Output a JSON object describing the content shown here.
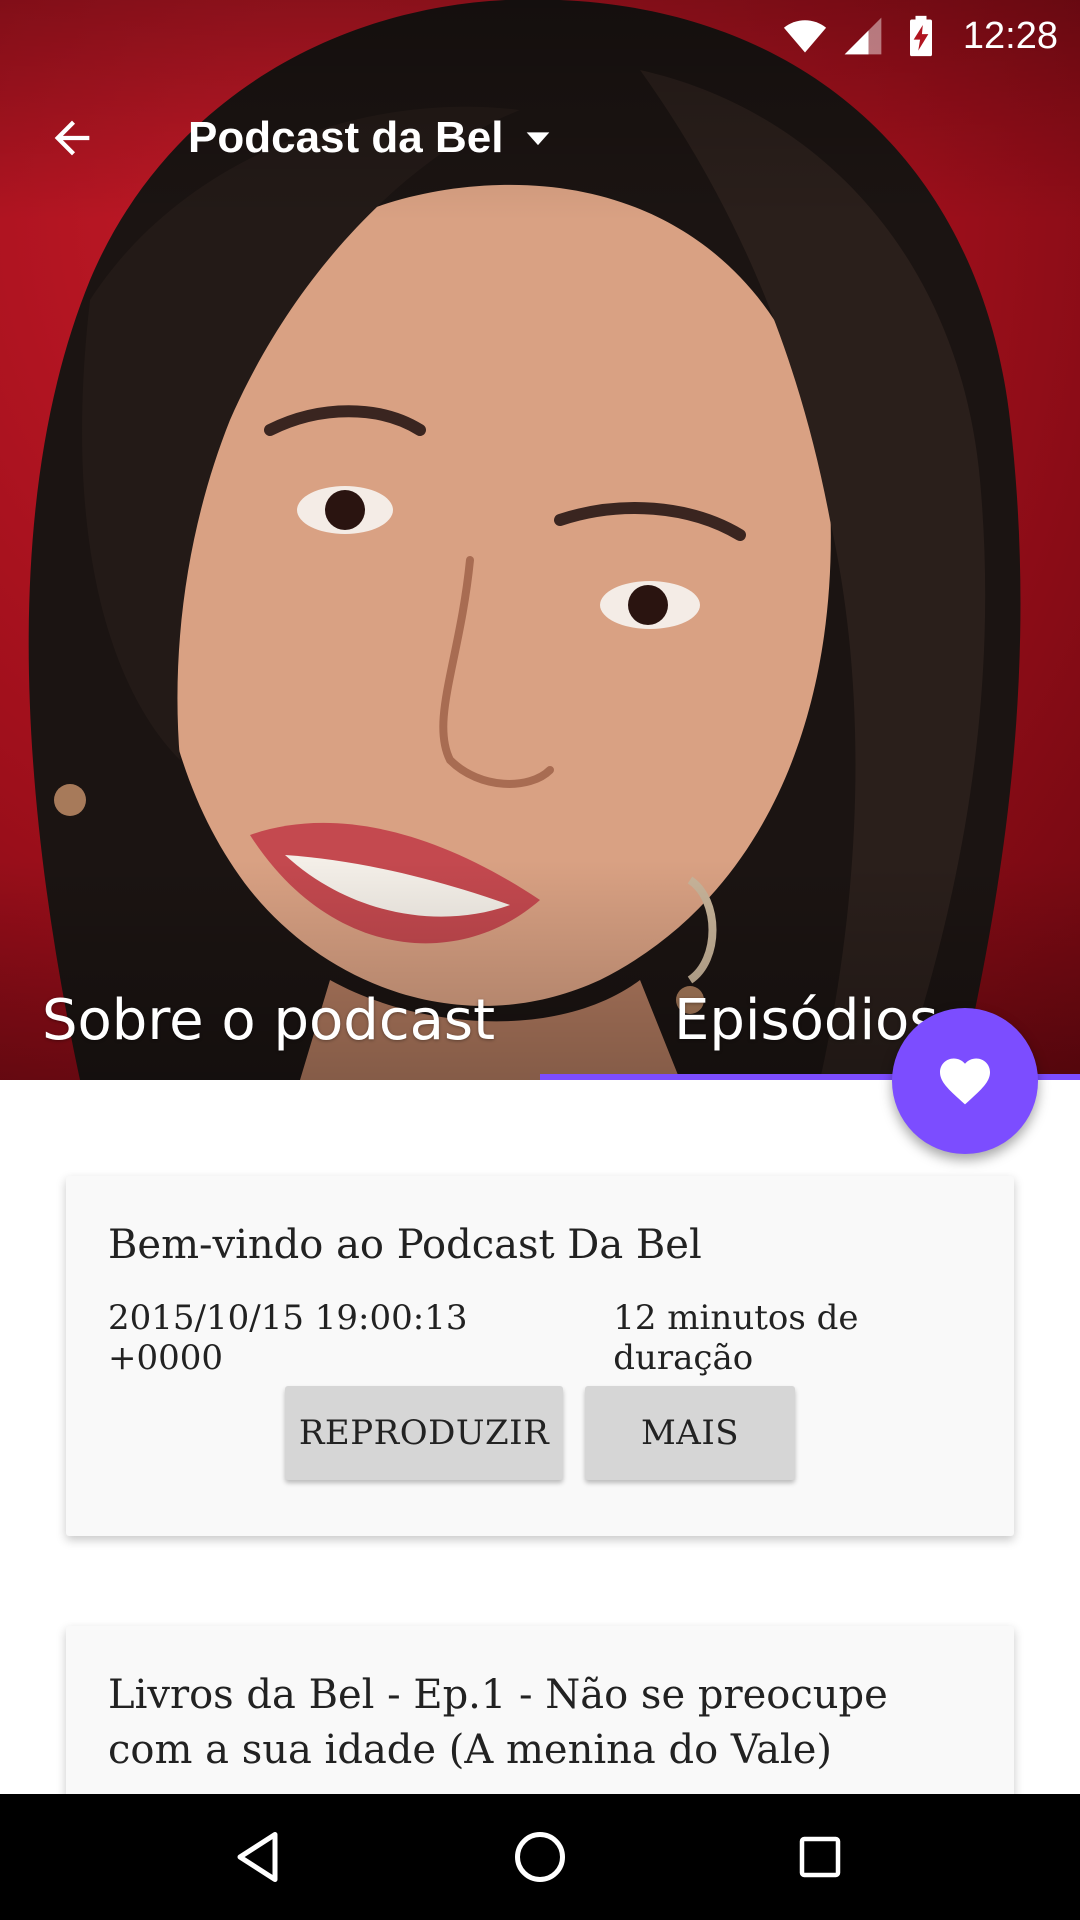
{
  "status_bar": {
    "time": "12:28",
    "icons": [
      "wifi-icon",
      "signal-icon",
      "battery-charging-icon"
    ]
  },
  "toolbar": {
    "back_icon": "arrow-back-icon",
    "title": "Podcast da Bel",
    "dropdown_icon": "arrow-drop-down-icon"
  },
  "hero": {
    "image": "podcast-host-photo"
  },
  "tabs": [
    {
      "label": "Sobre o podcast",
      "selected": false
    },
    {
      "label": "Episódios",
      "selected": true
    }
  ],
  "fab": {
    "icon": "heart-icon"
  },
  "episodes": [
    {
      "title": "Bem-vindo ao Podcast Da Bel",
      "date": "2015/10/15 19:00:13 +0000",
      "duration": "12 minutos de duração",
      "play_label": "REPRODUZIR",
      "more_label": "MAIS"
    },
    {
      "title": "Livros da Bel - Ep.1 - Não se preocupe com a sua idade (A menina do Vale)"
    }
  ],
  "nav_bar": {
    "back_icon": "nav-back-icon",
    "home_icon": "nav-home-icon",
    "recents_icon": "nav-recents-icon"
  },
  "colors": {
    "accent": "#7c4dff",
    "hero_background": "#b0141f",
    "card_background": "#f9f9f9",
    "button_background": "#d6d6d6"
  }
}
